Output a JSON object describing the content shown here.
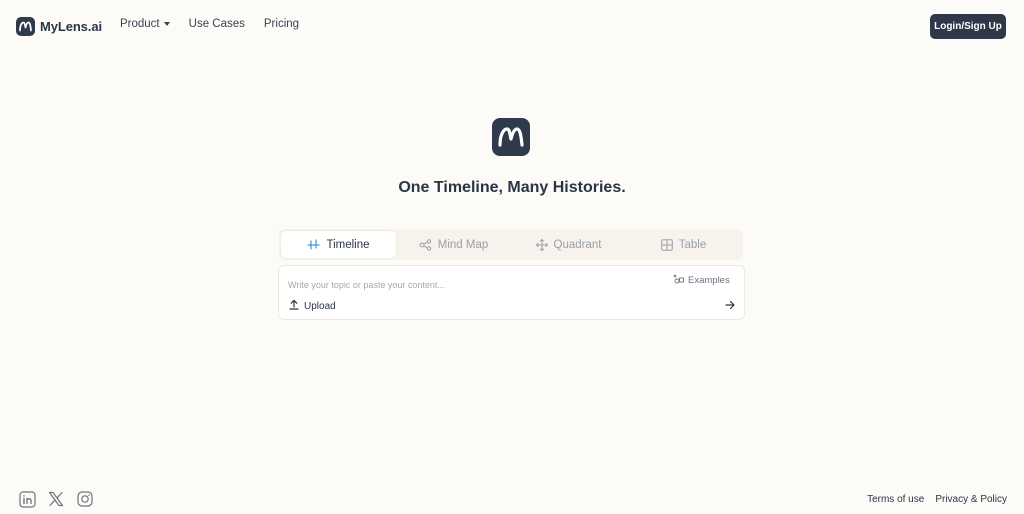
{
  "header": {
    "brand": {
      "name": "MyLens.ai",
      "logo_icon": "mylens-logo-icon"
    },
    "nav": [
      {
        "label": "Product",
        "has_dropdown": true
      },
      {
        "label": "Use Cases",
        "has_dropdown": false
      },
      {
        "label": "Pricing",
        "has_dropdown": false
      }
    ],
    "login_label": "Login/Sign Up"
  },
  "hero": {
    "logo_icon": "mylens-logo-icon",
    "title": "One Timeline, Many Histories."
  },
  "tabs": [
    {
      "label": "Timeline",
      "icon": "timeline-icon",
      "active": true
    },
    {
      "label": "Mind Map",
      "icon": "mind-map-icon",
      "active": false
    },
    {
      "label": "Quadrant",
      "icon": "quadrant-icon",
      "active": false
    },
    {
      "label": "Table",
      "icon": "table-icon",
      "active": false
    }
  ],
  "composer": {
    "placeholder": "Write your topic or paste your content...",
    "value": "",
    "examples_label": "Examples",
    "upload_label": "Upload",
    "submit_icon": "arrow-right-icon"
  },
  "footer": {
    "socials": [
      "linkedin-icon",
      "x-icon",
      "instagram-icon"
    ],
    "links": [
      "Terms of use",
      "Privacy & Policy"
    ]
  },
  "colors": {
    "background": "#fcfbf8",
    "primary_dark": "#2e3849",
    "tab_active_icon": "#4a90e2",
    "muted": "#9aa0a8"
  }
}
